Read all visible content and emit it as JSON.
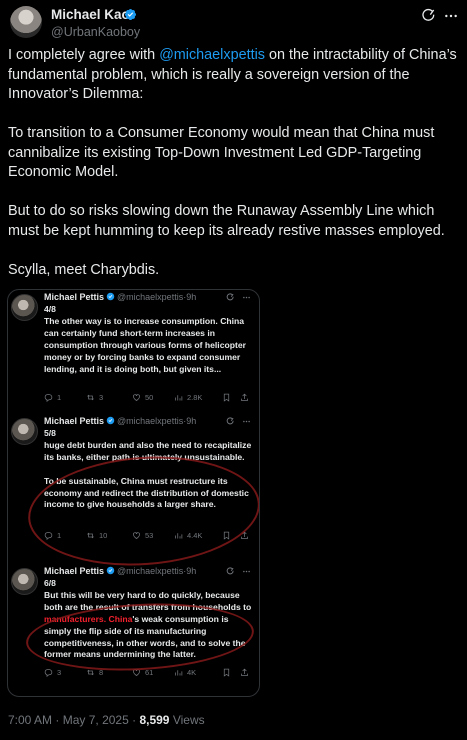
{
  "author": {
    "name": "Michael Kao",
    "handle": "@UrbanKaoboy"
  },
  "tweet": {
    "paragraphs": [
      {
        "before": "I completely agree with ",
        "mention": "@michaelxpettis",
        "after": " on the intractability of China’s fundamental problem, which is really a sovereign version of the Innovator’s Dilemma:"
      },
      {
        "text": "To transition to a Consumer Economy would mean that China must cannibalize its existing Top-Down Investment Led GDP-Targeting Economic Model."
      },
      {
        "text": "But to do so risks slowing down the Runaway Assembly Line which must be kept humming to keep its already restive masses employed."
      },
      {
        "text": "Scylla, meet Charybdis."
      }
    ]
  },
  "embedded": [
    {
      "name": "Michael Pettis",
      "handle": "@michaelxpettis",
      "sep": "·",
      "time": "9h",
      "count": "4/8",
      "paras": [
        [
          "The other way is to increase consumption. China can certainly fund short-term increases in consumption through various forms of helicopter money or by forcing banks to expand consumer lending, and it is doing both, but given its..."
        ]
      ],
      "replies": "1",
      "reposts": "3",
      "likes": "50",
      "views": "2.8K"
    },
    {
      "name": "Michael Pettis",
      "handle": "@michaelxpettis",
      "sep": "·",
      "time": "9h",
      "count": "5/8",
      "paras": [
        [
          "huge debt burden and also the need to recapitalize its banks, either path is ultimately unsustainable."
        ],
        [
          "To be sustainable, China must restructure its economy and redirect the distribution of domestic income to give households a larger share."
        ]
      ],
      "replies": "1",
      "reposts": "10",
      "likes": "53",
      "views": "4.4K"
    },
    {
      "name": "Michael Pettis",
      "handle": "@michaelxpettis",
      "sep": "·",
      "time": "9h",
      "count": "6/8",
      "text_a": "But this will be very hard to do quickly, because both are the result of transfers from households to ",
      "text_red_a": "manufacturers.",
      "text_b": " ",
      "text_red_b": "China",
      "text_c": "'s weak consumption is simply the flip side of its manufacturing competitiveness, in other words, and to solve the former means undermining the latter.",
      "replies": "3",
      "reposts": "8",
      "likes": "61",
      "views": "4K"
    }
  ],
  "footer": {
    "time": "7:00 AM",
    "sep": "·",
    "date": "May 7, 2025",
    "dot": "·",
    "views_count": "8,599",
    "views_label": "Views"
  },
  "icons": {
    "verified": "verified-badge-icon",
    "grok": "grok-icon",
    "more": "more-icon",
    "reply": "reply-icon",
    "repost": "repost-icon",
    "like": "like-icon",
    "views": "views-icon",
    "share": "share-icon"
  },
  "colors": {
    "accent": "#1d9bf0",
    "background": "#000000",
    "text": "#e7e9ea",
    "muted": "#71767b",
    "annotation_red": "#f4212e"
  }
}
